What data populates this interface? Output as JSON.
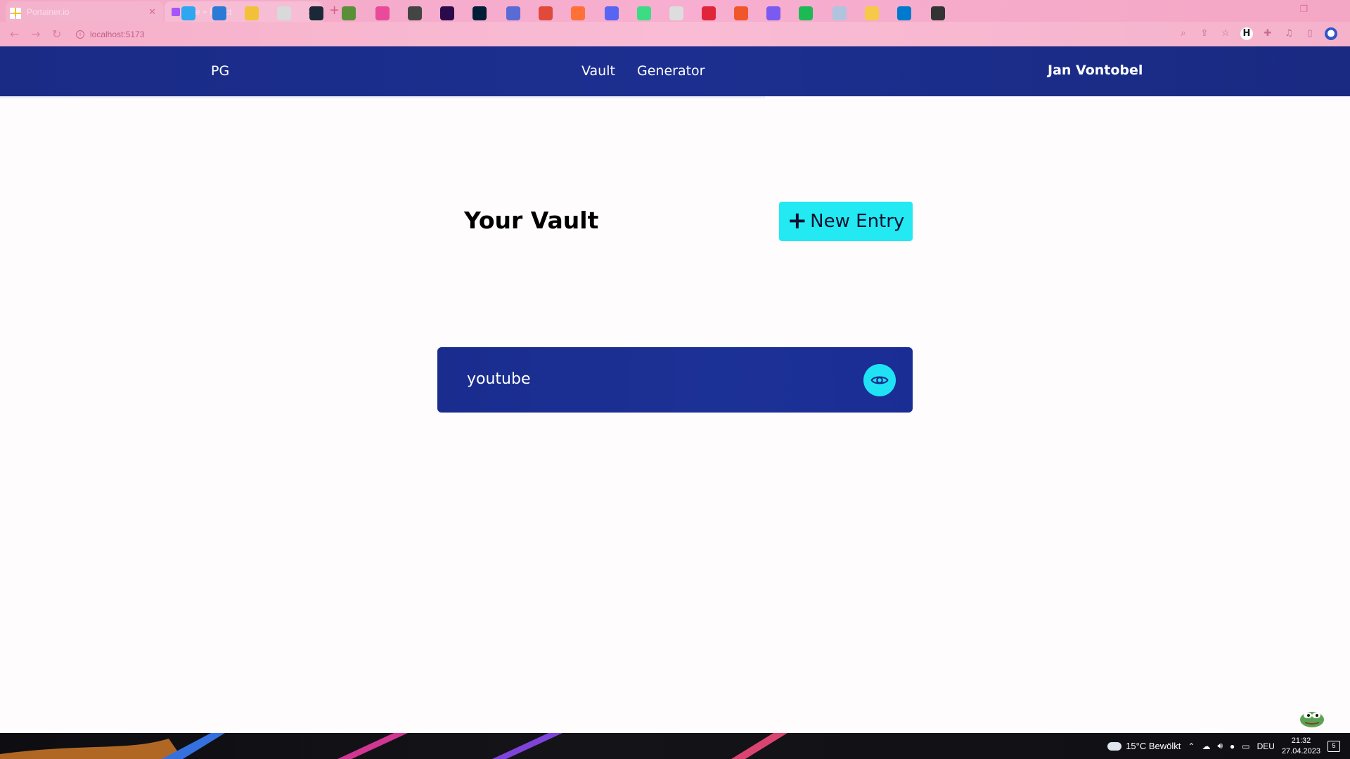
{
  "browser": {
    "tabs": [
      {
        "title": "Portainer.io",
        "favicon_color": "#f0c419"
      },
      {
        "title": "Vite + React",
        "favicon_color": "#a855f7"
      }
    ],
    "new_tab_label": "+",
    "address": "localhost:5173",
    "toolbar_icons": [
      "zoom-icon",
      "share-icon",
      "star-icon",
      "extension-h-icon",
      "puzzle-icon",
      "media-icon",
      "sidebar-icon",
      "profile-icon"
    ]
  },
  "app": {
    "brand": "PG",
    "nav": {
      "vault": "Vault",
      "generator": "Generator"
    },
    "user_name": "Jan Vontobel",
    "page_title": "Your Vault",
    "new_entry_button": {
      "icon": "+",
      "label": "New Entry"
    },
    "entries": [
      {
        "name": "youtube",
        "action_icon": "eye-icon"
      }
    ],
    "colors": {
      "navbar": "#1c2f90",
      "accent": "#22e9f2",
      "card": "#1c3196"
    }
  },
  "taskbar": {
    "weather": "15°C  Bewölkt",
    "language": "DEU",
    "time": "21:32",
    "date": "27.04.2023",
    "notification_count": "5"
  }
}
